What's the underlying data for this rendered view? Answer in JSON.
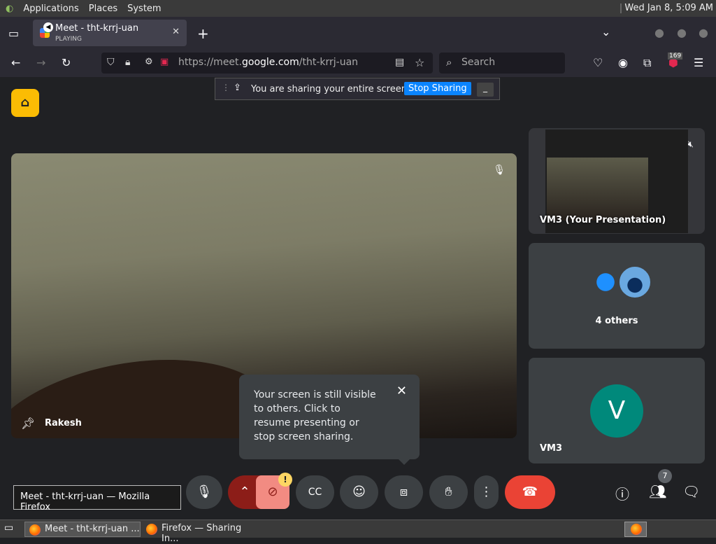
{
  "topbar": {
    "menu": [
      "Applications",
      "Places",
      "System"
    ],
    "clock": "Wed Jan  8,  5:09 AM"
  },
  "tab": {
    "title": "Meet - tht-krrj-uan",
    "subtitle": "PLAYING"
  },
  "navbar": {
    "url_prefix": "https://meet.",
    "url_domain": "google.com",
    "url_path": "/tht-krrj-uan",
    "search_placeholder": "Search",
    "notif_count": "169"
  },
  "share_notice": {
    "text": "You are sharing your entire screen.",
    "button": "Stop Sharing"
  },
  "main_video": {
    "participant": "Rakesh"
  },
  "tiles": {
    "presentation": "VM3 (Your Presentation)",
    "others": "4 others",
    "vm3_label": "VM3",
    "vm3_initial": "V"
  },
  "tooltip": {
    "text": "Your screen is still visible to others. Click to resume presenting or stop screen sharing."
  },
  "controls": {
    "participant_count": "7",
    "camera_badge": "!"
  },
  "window_tooltip": "Meet - tht-krrj-uan — Mozilla Firefox",
  "taskbar": {
    "task1": "Meet - tht-krrj-uan ...",
    "task2": "Firefox — Sharing In..."
  }
}
